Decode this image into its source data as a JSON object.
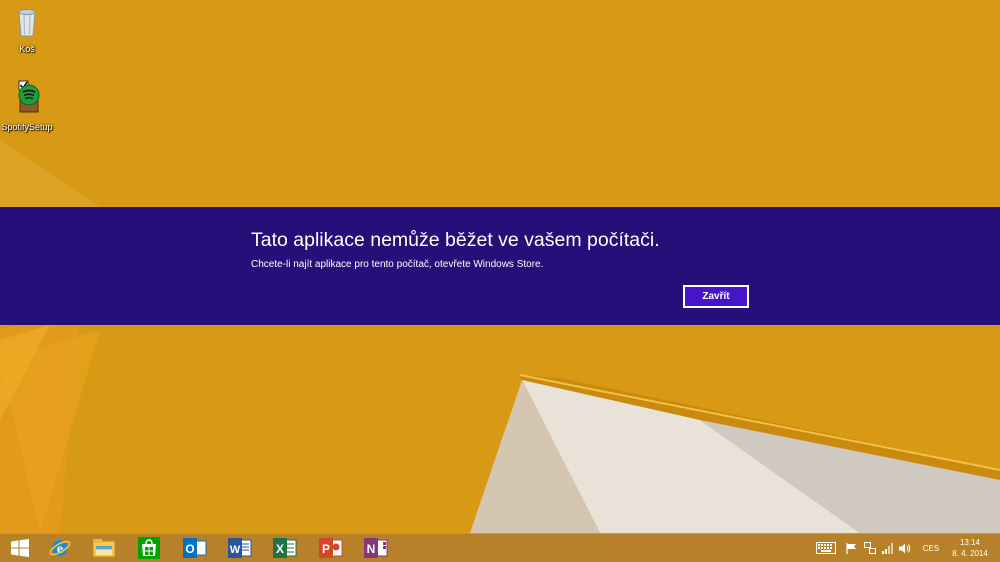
{
  "desktop": {
    "icons": [
      {
        "label": "Koš",
        "icon": "recycle-bin-icon"
      },
      {
        "label": "SpotifySetup",
        "icon": "spotify-setup-icon"
      }
    ]
  },
  "dialog": {
    "title": "Tato aplikace nemůže běžet ve vašem počítači.",
    "message": "Chcete-li najít aplikace pro tento počítač, otevřete Windows Store.",
    "close_label": "Zavřít"
  },
  "taskbar": {
    "pinned": [
      {
        "name": "start-button",
        "icon": "windows-logo-icon"
      },
      {
        "name": "internet-explorer",
        "icon": "internet-explorer-icon"
      },
      {
        "name": "file-explorer",
        "icon": "file-explorer-icon"
      },
      {
        "name": "windows-store",
        "icon": "store-icon"
      },
      {
        "name": "outlook",
        "icon": "outlook-icon"
      },
      {
        "name": "word",
        "icon": "word-icon"
      },
      {
        "name": "excel",
        "icon": "excel-icon"
      },
      {
        "name": "powerpoint",
        "icon": "powerpoint-icon"
      },
      {
        "name": "onenote",
        "icon": "onenote-icon"
      }
    ],
    "tray": {
      "language": "CES",
      "time": "13:14",
      "date": "8. 4. 2014"
    }
  },
  "colors": {
    "wallpaper": "#d99b12",
    "dialog_bg": "#25107a",
    "button_bg": "#4715c9",
    "taskbar": "#b7812a"
  }
}
